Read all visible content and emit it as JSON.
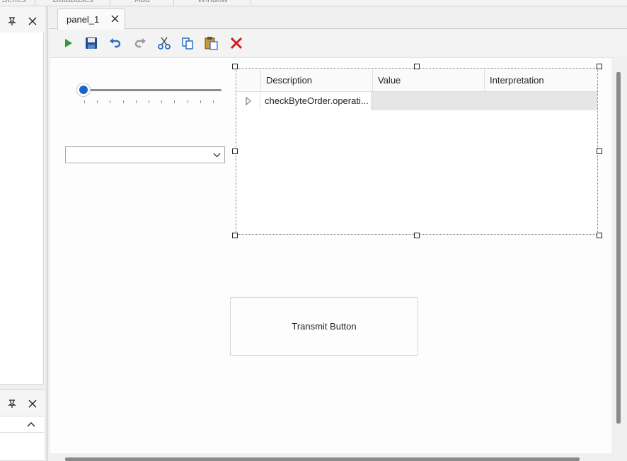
{
  "menu": {
    "items": [
      "Series",
      "Databases",
      "Add",
      "Window"
    ]
  },
  "left_panel": {
    "top_buttons": [
      "pin-icon",
      "close-icon"
    ],
    "bottom_buttons": [
      "pin-icon",
      "close-icon"
    ],
    "collapse_icon": "chevron-up-icon"
  },
  "document": {
    "tab": {
      "label": "panel_1",
      "close_icon": "close-icon"
    },
    "toolbar": [
      {
        "name": "run-icon",
        "color": "#2f9a3a"
      },
      {
        "name": "save-icon",
        "color": "#1f4e8c"
      },
      {
        "name": "undo-icon",
        "color": "#2a6cc4"
      },
      {
        "name": "redo-icon",
        "color": "#9a9a9a"
      },
      {
        "name": "cut-icon",
        "color": "#2a6cc4"
      },
      {
        "name": "copy-icon",
        "color": "#2a6cc4"
      },
      {
        "name": "paste-icon",
        "color": "#c99a2e"
      },
      {
        "name": "delete-icon",
        "color": "#d11f1f"
      }
    ]
  },
  "slider": {
    "value": 0,
    "tick_count": 11
  },
  "combo": {
    "value": ""
  },
  "grid": {
    "columns": [
      "Description",
      "Value",
      "Interpretation"
    ],
    "rows": [
      {
        "description": "checkByteOrder.operati...",
        "value": "",
        "interpretation": ""
      }
    ]
  },
  "transmit_button": {
    "label": "Transmit Button"
  }
}
